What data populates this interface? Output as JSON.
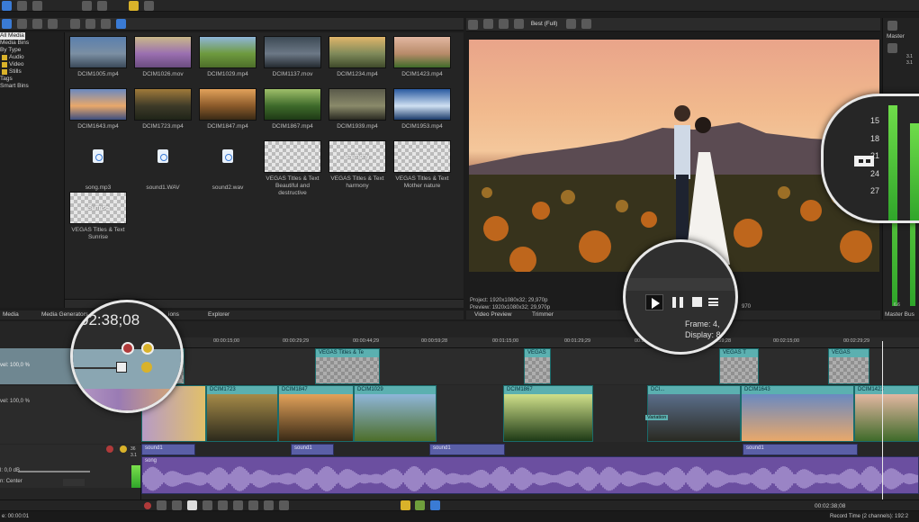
{
  "menu_icons": [
    "folder-icon",
    "save-icon",
    "gear-icon"
  ],
  "explorer": {
    "tree": [
      "All Media",
      "Media Bins",
      "By Type",
      "Audio",
      "Video",
      "Stills",
      "Tags",
      "Smart Bins"
    ],
    "items": [
      {
        "name": "DCIM1005.mp4",
        "kind": "video",
        "colors": [
          "#5a7fae",
          "#7b8fa3",
          "#3b4a5a"
        ]
      },
      {
        "name": "DCIM1026.mov",
        "kind": "video",
        "colors": [
          "#c9b88a",
          "#9a6fb0",
          "#6b4c80"
        ]
      },
      {
        "name": "DCIM1029.mp4",
        "kind": "video",
        "colors": [
          "#8fb6d9",
          "#6e9a3e",
          "#4d6e2a"
        ]
      },
      {
        "name": "DCIM1137.mov",
        "kind": "video",
        "colors": [
          "#3d4a55",
          "#6c7886",
          "#242a30"
        ]
      },
      {
        "name": "DCIM1234.mp4",
        "kind": "video",
        "colors": [
          "#e0b56a",
          "#7f8a5a",
          "#3f4a2a"
        ]
      },
      {
        "name": "DCIM1423.mp4",
        "kind": "video",
        "colors": [
          "#e2b7a1",
          "#b88b6a",
          "#3f6b2a"
        ]
      },
      {
        "name": "DCIM1643.mp4",
        "kind": "video",
        "colors": [
          "#6a89c1",
          "#e9a86a",
          "#3c4e80"
        ]
      },
      {
        "name": "DCIM1723.mp4",
        "kind": "video",
        "colors": [
          "#a07a3a",
          "#3e3a28",
          "#1f2418"
        ]
      },
      {
        "name": "DCIM1847.mp4",
        "kind": "video",
        "colors": [
          "#e2a25a",
          "#8b5a2a",
          "#3a2a16"
        ]
      },
      {
        "name": "DCIM1867.mp4",
        "kind": "video",
        "colors": [
          "#9fbf6a",
          "#3e6a2a",
          "#1e3a16"
        ]
      },
      {
        "name": "DCIM1939.mp4",
        "kind": "video",
        "colors": [
          "#5a5a4a",
          "#8a8a6a",
          "#2a2a22"
        ]
      },
      {
        "name": "DCIM1953.mp4",
        "kind": "video",
        "colors": [
          "#2a5aa0",
          "#cfe0f2",
          "#1a3a6a"
        ]
      },
      {
        "name": "song.mp3",
        "kind": "audio"
      },
      {
        "name": "sound1.WAV",
        "kind": "audio"
      },
      {
        "name": "sound2.wav",
        "kind": "audio"
      },
      {
        "name": "VEGAS Titles & Text Beautiful and destructive",
        "kind": "title",
        "overlay": ""
      },
      {
        "name": "VEGAS Titles & Text harmony",
        "kind": "title",
        "overlay": "harmony"
      },
      {
        "name": "VEGAS Titles & Text Mother nature",
        "kind": "title",
        "overlay": ""
      },
      {
        "name": "VEGAS Titles & Text Sunrise",
        "kind": "title",
        "overlay": "Sunrise"
      }
    ],
    "tabs": [
      "Media",
      "Media Generators",
      "ions",
      "Explorer"
    ]
  },
  "preview": {
    "quality": "Best (Full)",
    "project_label": "Project:",
    "project_value": "1920x1080x32; 29,970p",
    "preview_label": "Preview:",
    "preview_value": "1920x1080x32; 29,970p",
    "frame_value_partial": "970",
    "tabs": [
      "Video Preview",
      "Trimmer"
    ],
    "lens_frame_label": "Frame:",
    "lens_frame_value": "4,",
    "lens_display_label": "Display:",
    "lens_display_value": "8"
  },
  "master": {
    "title": "Master",
    "scale": [
      "3.1",
      "3.1"
    ],
    "lens_ticks": [
      "15",
      "18",
      "21",
      "24",
      "27"
    ],
    "bottom_tab": "Master Bus",
    "bottom_left": "6.6"
  },
  "timeline": {
    "timecode": "02:38;08",
    "ruler": [
      "00:00:15;00",
      "00:00:29;29",
      "00:00:44;29",
      "00:00:59;28",
      "00:01:15;00",
      "00:01:29;29",
      "00:01:44;29",
      "00:01:59;28",
      "00:02:15;00",
      "00:02:29;29"
    ],
    "track1_level": "vel: 100,0 %",
    "track2_level": "vel: 100,0 %",
    "audio_vol": "0,0 dB",
    "audio_pan": "Center",
    "audio_pan_label": "n:",
    "audio_vol_label": "l:",
    "meter_labels": [
      "36",
      "3.1"
    ],
    "title_events": [
      {
        "label": "VEGAS"
      },
      {
        "label": "VEGAS Titles & Te"
      },
      {
        "label": "VEGAS"
      },
      {
        "label": "VEGAS T"
      },
      {
        "label": "VEGAS"
      }
    ],
    "video_events": [
      {
        "label": "DCIM1723"
      },
      {
        "label": "DCIM1847"
      },
      {
        "label": "DCIM1029"
      },
      {
        "label": "DCIM1867"
      },
      {
        "label": "DCI..."
      },
      {
        "label": "DCIM1643"
      },
      {
        "label": "DCIM1423"
      }
    ],
    "sound_events": [
      "sound1",
      "sound1",
      "sound1",
      "sound1"
    ],
    "song_label": "song",
    "transition_label": "Variation"
  },
  "status": {
    "left": "e: 00:00:01",
    "time": "00:02:38;08",
    "record": "Record Time (2 channels): 192:2"
  }
}
